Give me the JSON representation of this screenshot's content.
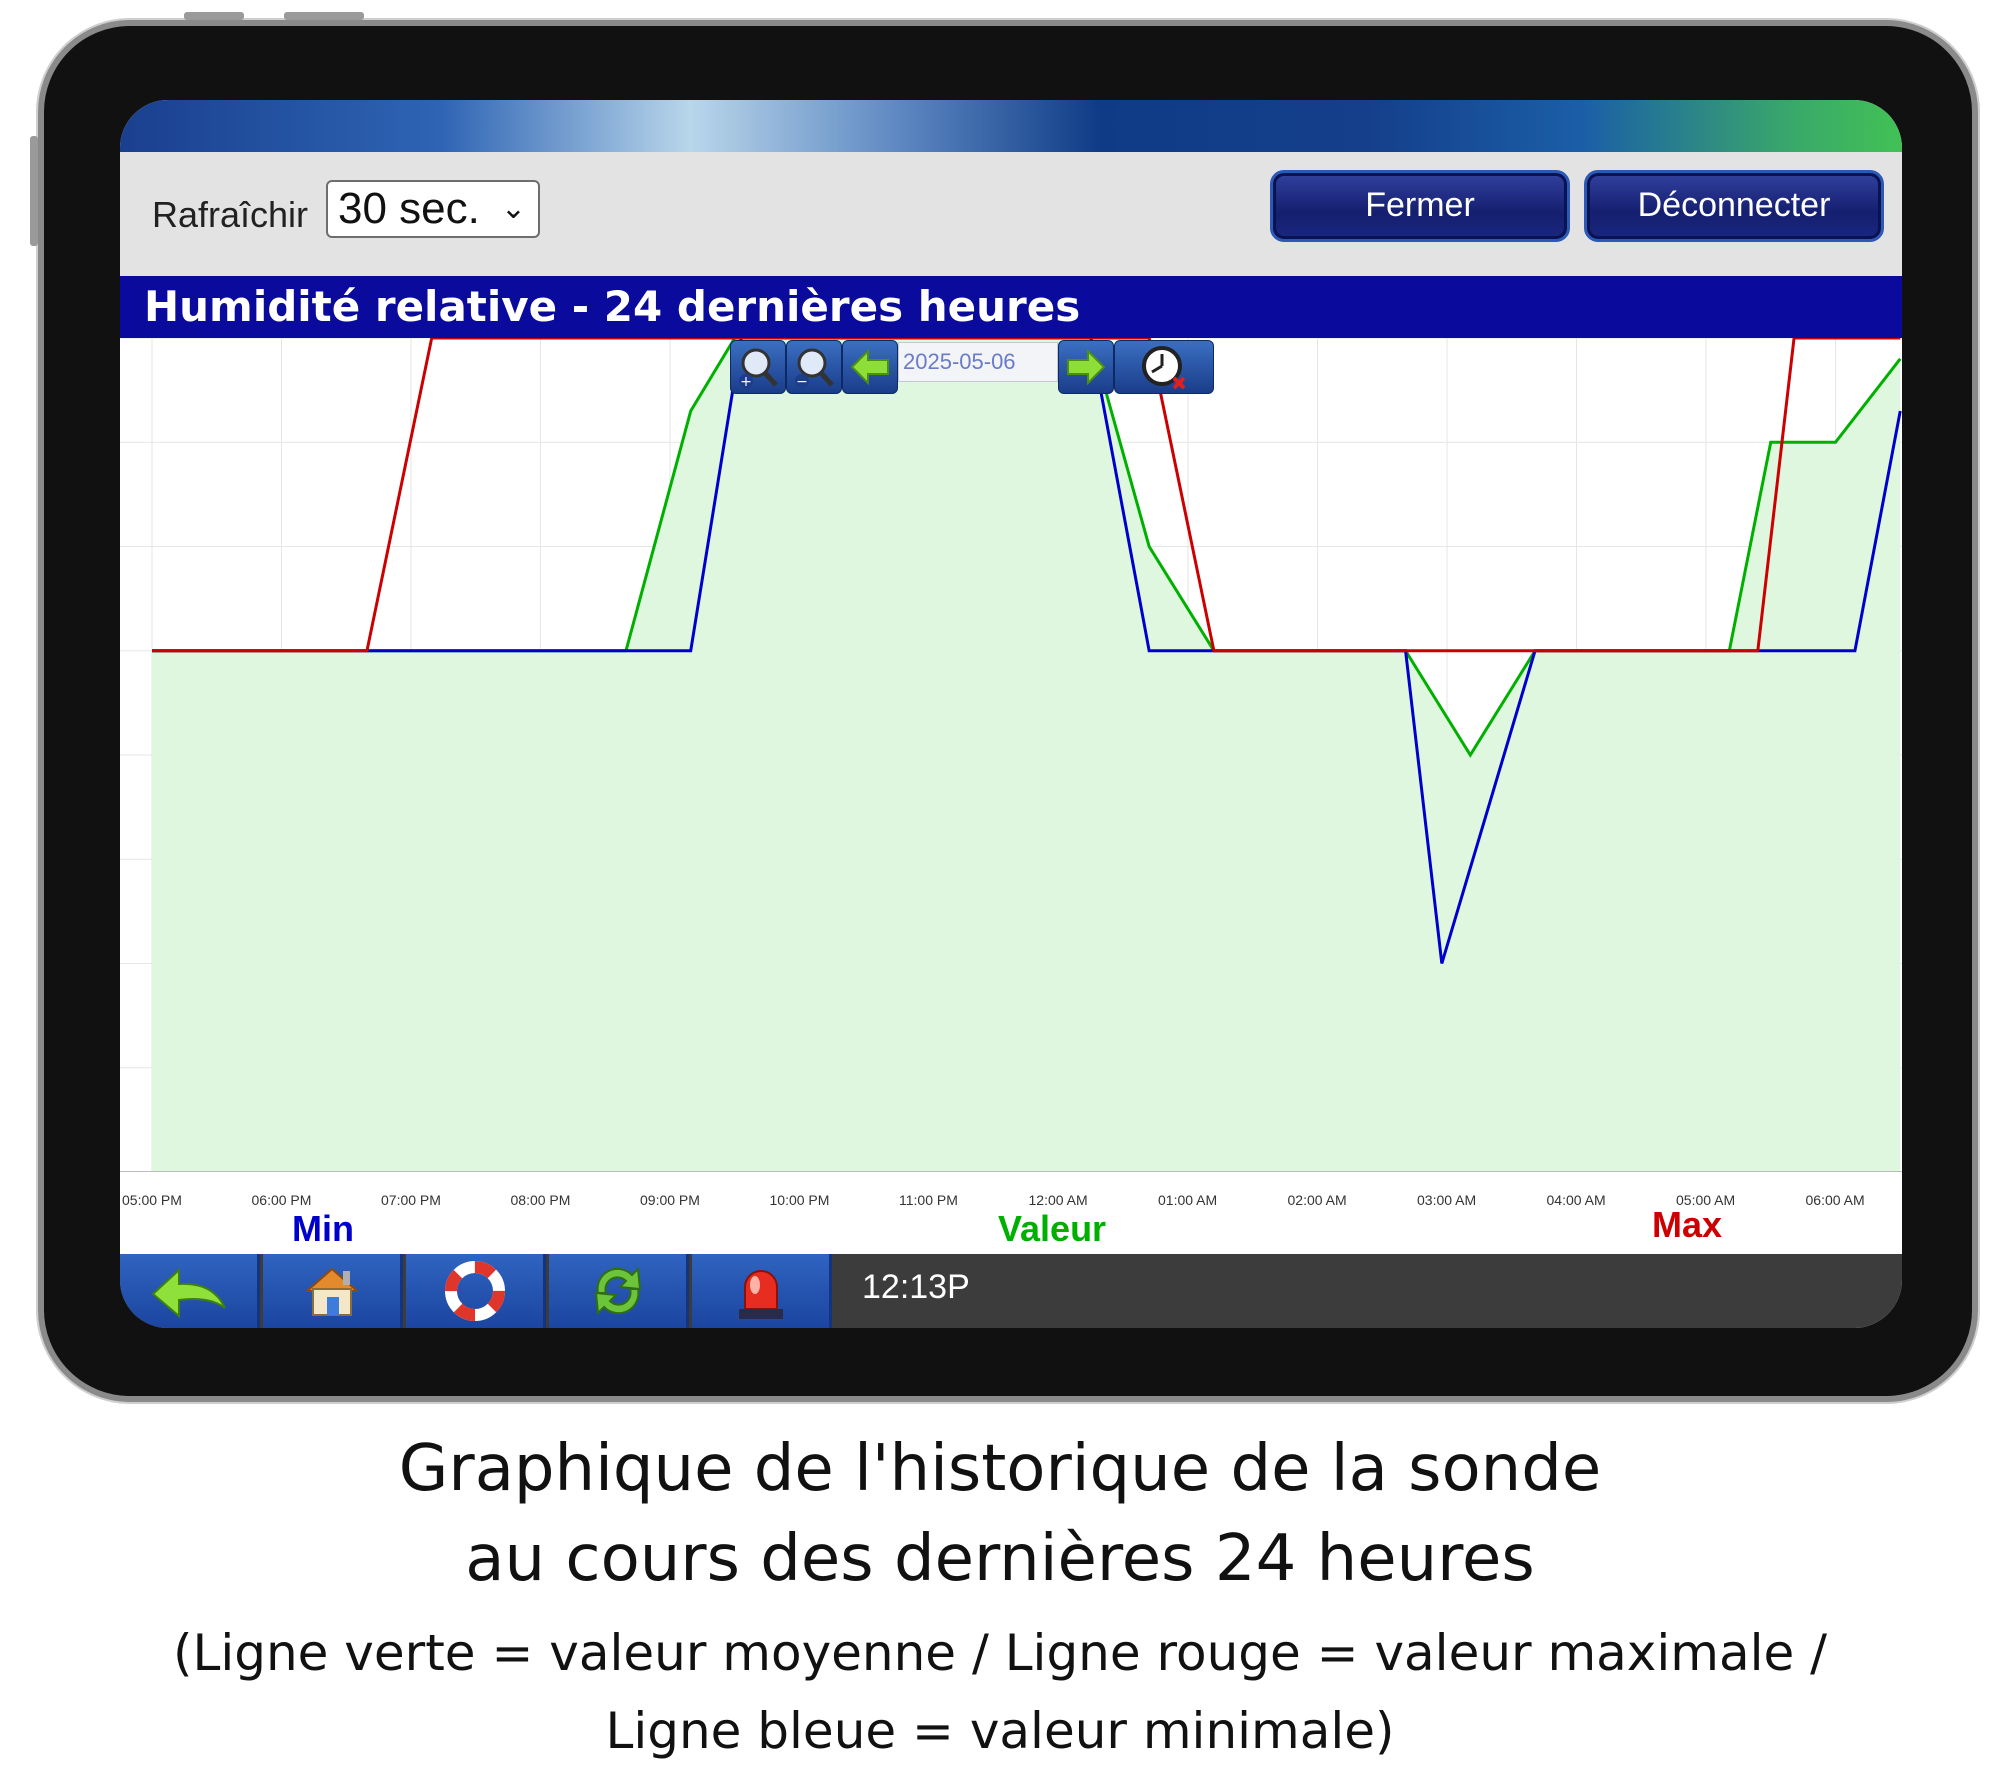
{
  "toolbar": {
    "refresh_label": "Rafraîchir",
    "refresh_value": "30 sec.",
    "close_label": "Fermer",
    "disconnect_label": "Déconnecter"
  },
  "chart_title": "Humidité relative - 24 dernières heures",
  "chart_nav": {
    "date": "2025-05-06",
    "icons": [
      "zoom-in-icon",
      "zoom-out-icon",
      "arrow-left-icon",
      "arrow-right-icon",
      "clock-reset-icon"
    ]
  },
  "legend": {
    "min": "Min",
    "value": "Valeur",
    "max": "Max",
    "min_color": "#0000cc",
    "value_color": "#00b000",
    "max_color": "#cc0000"
  },
  "bottom": {
    "time": "12:13P",
    "icons": [
      "back-arrow-icon",
      "home-icon",
      "lifebuoy-icon",
      "refresh-icon",
      "alarm-beacon-icon"
    ]
  },
  "caption": {
    "line1": "Graphique de l'historique de la sonde",
    "line2": "au cours des dernières 24 heures",
    "line3": "(Ligne verte = valeur moyenne / Ligne rouge = valeur maximale /",
    "line4": "Ligne bleue = valeur minimale)"
  },
  "chart_data": {
    "type": "line",
    "x_labels": [
      "05:00 PM",
      "06:00 PM",
      "07:00 PM",
      "08:00 PM",
      "09:00 PM",
      "10:00 PM",
      "11:00 PM",
      "12:00 AM",
      "01:00 AM",
      "02:00 AM",
      "03:00 AM",
      "04:00 AM",
      "05:00 AM",
      "06:00 AM"
    ],
    "x_range": [
      0,
      13.5
    ],
    "y_range": [
      0,
      8
    ],
    "series": [
      {
        "name": "Max",
        "color": "#cc0000",
        "x": [
          0,
          1.66,
          2.16,
          7.7,
          8.2,
          12.4,
          12.68,
          13.5
        ],
        "y": [
          5,
          5,
          8,
          8,
          5,
          5,
          8,
          8
        ]
      },
      {
        "name": "Valeur",
        "color": "#00b000",
        "x": [
          0,
          3.66,
          4.16,
          4.5,
          7.25,
          7.7,
          8.2,
          9.68,
          10.18,
          10.68,
          12.18,
          12.5,
          13.0,
          13.5
        ],
        "y": [
          5,
          5,
          7.3,
          8,
          8,
          6,
          5,
          5,
          4,
          5,
          5,
          7,
          7,
          7.8
        ]
      },
      {
        "name": "Min",
        "color": "#0000cc",
        "x": [
          0,
          4.16,
          4.55,
          7.25,
          7.7,
          9.68,
          9.96,
          10.68,
          13.15,
          13.5
        ],
        "y": [
          5,
          5,
          8,
          8,
          5,
          5,
          2,
          5,
          5,
          7.3
        ]
      }
    ]
  }
}
